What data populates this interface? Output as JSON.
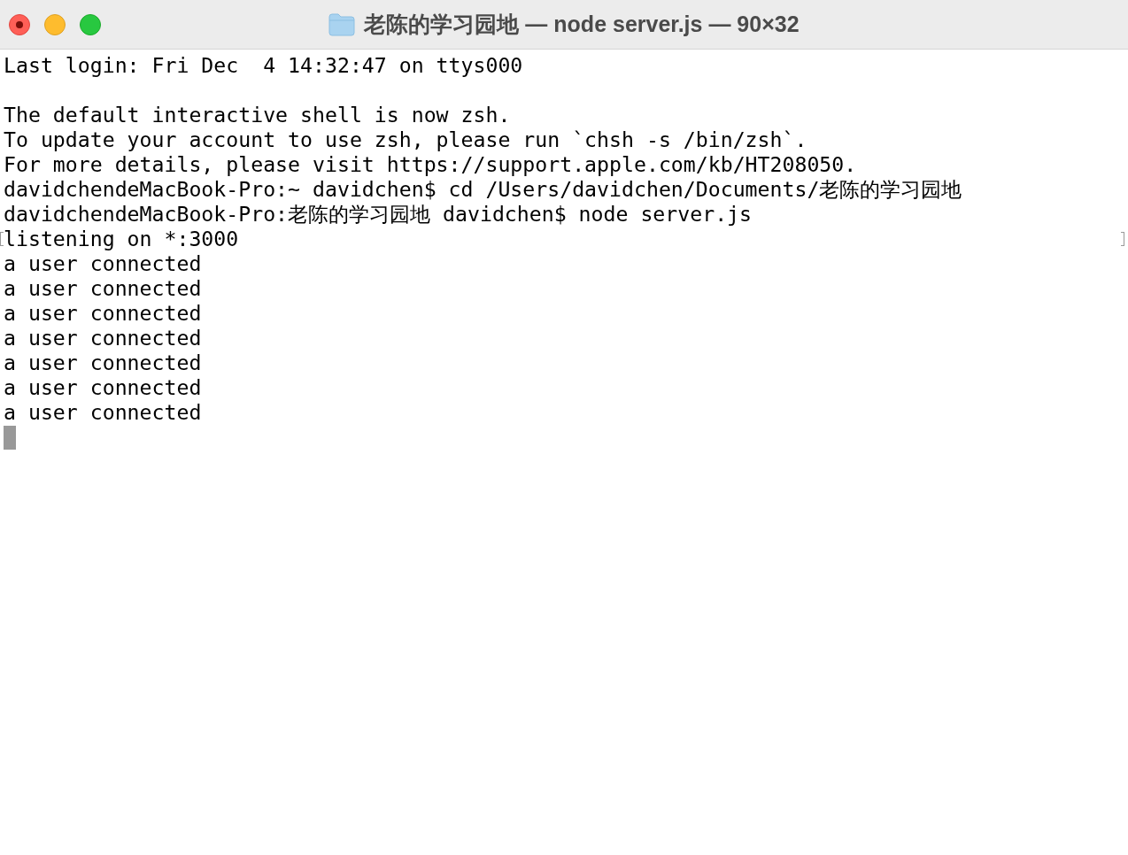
{
  "window": {
    "title": "老陈的学习园地 — node server.js — 90×32"
  },
  "terminal": {
    "lines": [
      {
        "text": "Last login: Fri Dec  4 14:32:47 on ttys000",
        "marked": false
      },
      {
        "marked": false
      },
      {
        "text": "The default interactive shell is now zsh.",
        "marked": false
      },
      {
        "text": "To update your account to use zsh, please run `chsh -s /bin/zsh`.",
        "marked": false
      },
      {
        "text": "For more details, please visit https://support.apple.com/kb/HT208050.",
        "marked": false
      },
      {
        "text": "davidchendeMacBook-Pro:~ davidchen$ cd /Users/davidchen/Documents/老陈的学习园地",
        "marked": false
      },
      {
        "text": "davidchendeMacBook-Pro:老陈的学习园地 davidchen$ node server.js",
        "marked": false
      },
      {
        "text": "listening on *:3000",
        "marked": true
      },
      {
        "text": "a user connected",
        "marked": false
      },
      {
        "text": "a user connected",
        "marked": false
      },
      {
        "text": "a user connected",
        "marked": false
      },
      {
        "text": "a user connected",
        "marked": false
      },
      {
        "text": "a user connected",
        "marked": false
      },
      {
        "text": "a user connected",
        "marked": false
      },
      {
        "text": "a user connected",
        "marked": false
      }
    ]
  }
}
